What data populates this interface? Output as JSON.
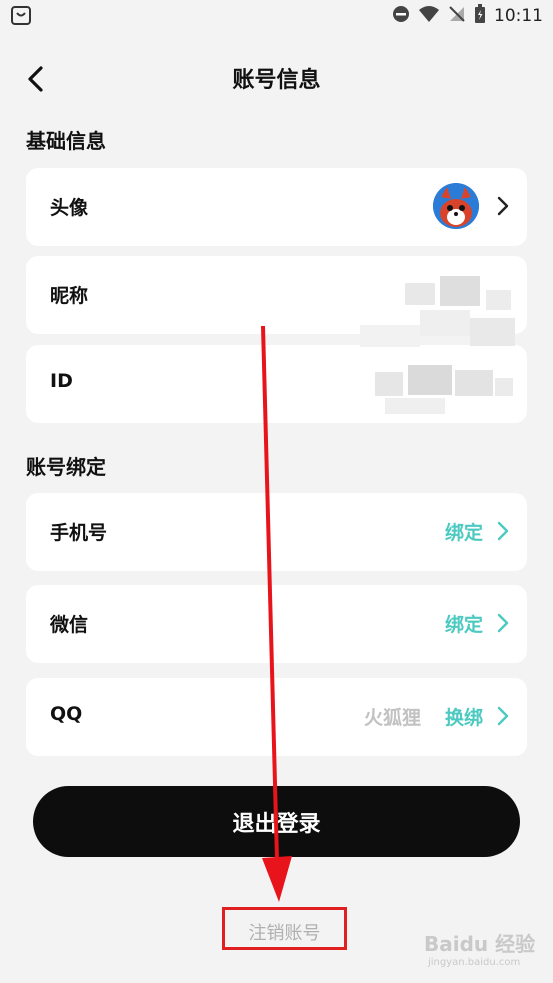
{
  "status_bar": {
    "time": "10:11"
  },
  "header": {
    "title": "账号信息"
  },
  "basic_section": {
    "title": "基础信息",
    "avatar_label": "头像",
    "nickname_label": "昵称",
    "id_label": "ID"
  },
  "binding_section": {
    "title": "账号绑定",
    "phone": {
      "label": "手机号",
      "action": "绑定"
    },
    "wechat": {
      "label": "微信",
      "action": "绑定"
    },
    "qq": {
      "label": "QQ",
      "value": "火狐狸",
      "action": "换绑"
    }
  },
  "logout_label": "退出登录",
  "cancel_account_label": "注销账号",
  "watermark": {
    "brand": "Baidu 经验",
    "url": "jingyan.baidu.com"
  },
  "colors": {
    "accent": "#4cc9c0",
    "highlight": "#e02020",
    "button_bg": "#0d0d0d"
  }
}
